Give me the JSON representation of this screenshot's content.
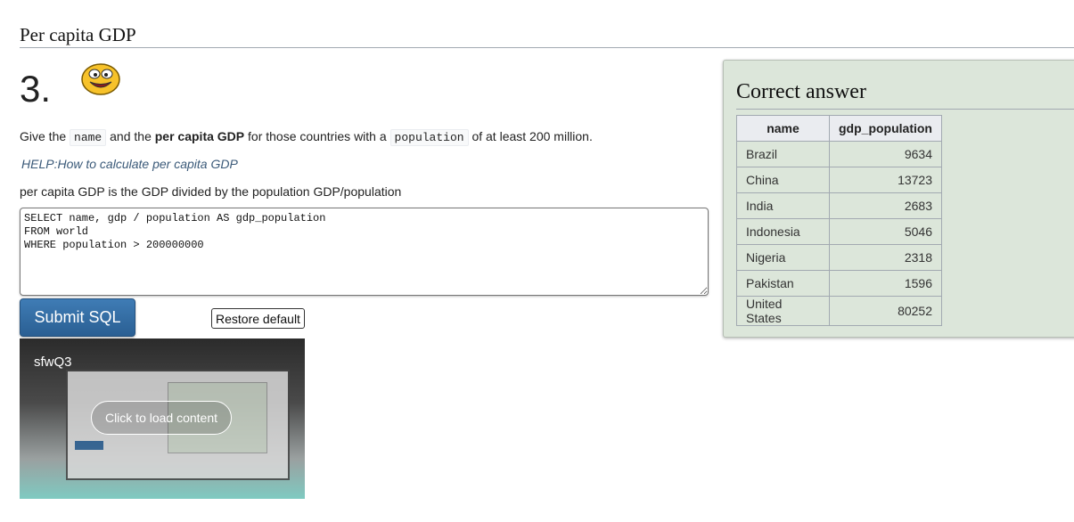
{
  "section": {
    "title": "Per capita GDP"
  },
  "question": {
    "number": "3.",
    "text_parts": [
      "Give the ",
      "name",
      " and the ",
      "per capita GDP",
      " for those countries with a ",
      "population",
      " of at least 200 million."
    ],
    "help_link": "HELP:How to calculate per capita GDP",
    "hint": "per capita GDP is the GDP divided by the population GDP/population"
  },
  "editor": {
    "sql": "SELECT name, gdp / population AS gdp_population\nFROM world\nWHERE population > 200000000"
  },
  "buttons": {
    "submit": "Submit SQL",
    "restore": "Restore default"
  },
  "video": {
    "title": "sfwQ3",
    "load_label": "Click to load content"
  },
  "answer": {
    "title": "Correct answer",
    "columns": [
      "name",
      "gdp_population"
    ],
    "rows": [
      [
        "Brazil",
        "9634"
      ],
      [
        "China",
        "13723"
      ],
      [
        "India",
        "2683"
      ],
      [
        "Indonesia",
        "5046"
      ],
      [
        "Nigeria",
        "2318"
      ],
      [
        "Pakistan",
        "1596"
      ],
      [
        "United States",
        "80252"
      ]
    ]
  },
  "icons": {
    "smiley": "smiley-face-icon"
  },
  "colors": {
    "answer_bg": "#dce6da",
    "submit_bg": "#2a5f93",
    "link": "#3b5a79"
  }
}
